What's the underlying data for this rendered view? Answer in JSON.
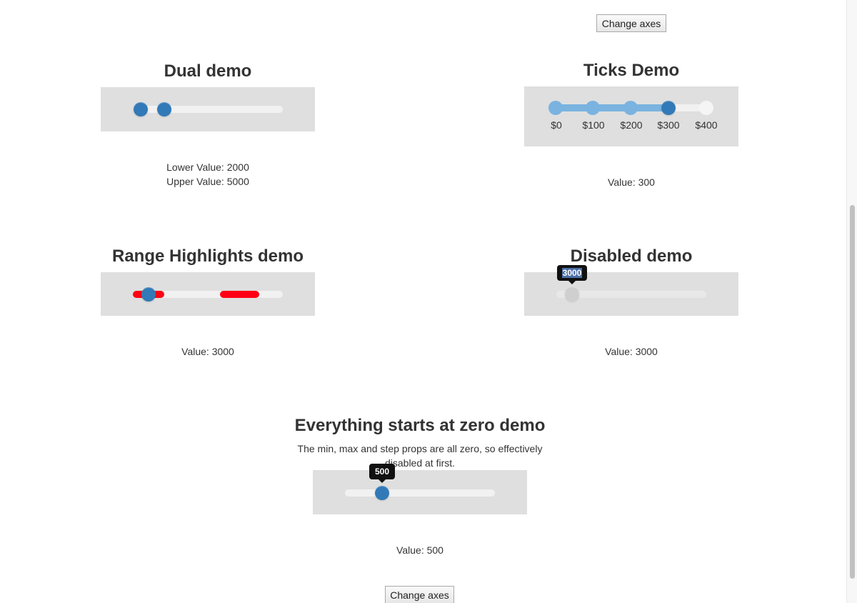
{
  "top_button": {
    "label": "Change axes"
  },
  "bottom_button": {
    "label": "Change axes"
  },
  "dual_demo": {
    "title": "Dual demo",
    "lower_text": "Lower Value: 2000",
    "upper_text": "Upper Value: 5000",
    "lower_value": 2000,
    "upper_value": 5000,
    "handle_color": "#3279b7"
  },
  "ticks_demo": {
    "title": "Ticks Demo",
    "ticks": [
      "$0",
      "$100",
      "$200",
      "$300",
      "$400"
    ],
    "value": 300,
    "value_text": "Value: 300",
    "tick_fill_color": "#7ab3e0",
    "handle_color": "#3279b7"
  },
  "range_demo": {
    "title": "Range Highlights demo",
    "value": 3000,
    "value_text": "Value: 3000",
    "highlight_color": "#ff0014"
  },
  "disabled_demo": {
    "title": "Disabled demo",
    "tooltip": "3000",
    "value": 3000,
    "value_text": "Value: 3000"
  },
  "zero_demo": {
    "title": "Everything starts at zero demo",
    "description": "The min, max and step props are all zero, so effectively disabled at first.",
    "tooltip": "500",
    "value": 500,
    "value_text": "Value: 500"
  }
}
